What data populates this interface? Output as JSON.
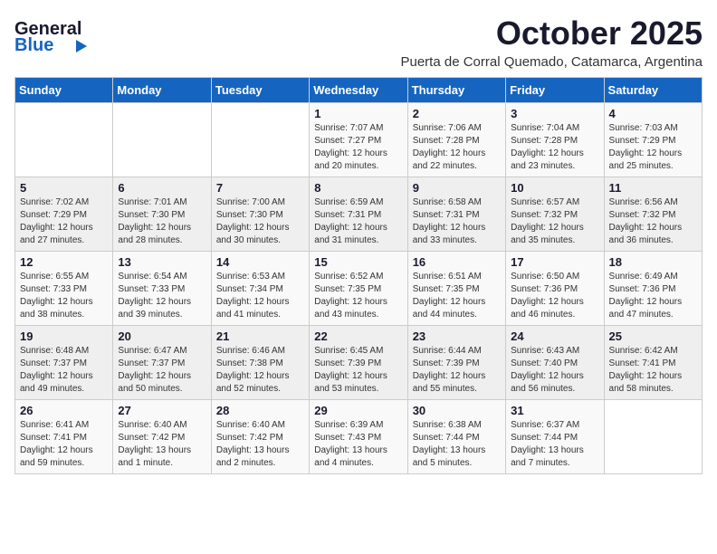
{
  "header": {
    "logo_general": "General",
    "logo_blue": "Blue",
    "month_title": "October 2025",
    "subtitle": "Puerta de Corral Quemado, Catamarca, Argentina"
  },
  "calendar": {
    "days_of_week": [
      "Sunday",
      "Monday",
      "Tuesday",
      "Wednesday",
      "Thursday",
      "Friday",
      "Saturday"
    ],
    "weeks": [
      [
        {
          "day": "",
          "info": ""
        },
        {
          "day": "",
          "info": ""
        },
        {
          "day": "",
          "info": ""
        },
        {
          "day": "1",
          "info": "Sunrise: 7:07 AM\nSunset: 7:27 PM\nDaylight: 12 hours\nand 20 minutes."
        },
        {
          "day": "2",
          "info": "Sunrise: 7:06 AM\nSunset: 7:28 PM\nDaylight: 12 hours\nand 22 minutes."
        },
        {
          "day": "3",
          "info": "Sunrise: 7:04 AM\nSunset: 7:28 PM\nDaylight: 12 hours\nand 23 minutes."
        },
        {
          "day": "4",
          "info": "Sunrise: 7:03 AM\nSunset: 7:29 PM\nDaylight: 12 hours\nand 25 minutes."
        }
      ],
      [
        {
          "day": "5",
          "info": "Sunrise: 7:02 AM\nSunset: 7:29 PM\nDaylight: 12 hours\nand 27 minutes."
        },
        {
          "day": "6",
          "info": "Sunrise: 7:01 AM\nSunset: 7:30 PM\nDaylight: 12 hours\nand 28 minutes."
        },
        {
          "day": "7",
          "info": "Sunrise: 7:00 AM\nSunset: 7:30 PM\nDaylight: 12 hours\nand 30 minutes."
        },
        {
          "day": "8",
          "info": "Sunrise: 6:59 AM\nSunset: 7:31 PM\nDaylight: 12 hours\nand 31 minutes."
        },
        {
          "day": "9",
          "info": "Sunrise: 6:58 AM\nSunset: 7:31 PM\nDaylight: 12 hours\nand 33 minutes."
        },
        {
          "day": "10",
          "info": "Sunrise: 6:57 AM\nSunset: 7:32 PM\nDaylight: 12 hours\nand 35 minutes."
        },
        {
          "day": "11",
          "info": "Sunrise: 6:56 AM\nSunset: 7:32 PM\nDaylight: 12 hours\nand 36 minutes."
        }
      ],
      [
        {
          "day": "12",
          "info": "Sunrise: 6:55 AM\nSunset: 7:33 PM\nDaylight: 12 hours\nand 38 minutes."
        },
        {
          "day": "13",
          "info": "Sunrise: 6:54 AM\nSunset: 7:33 PM\nDaylight: 12 hours\nand 39 minutes."
        },
        {
          "day": "14",
          "info": "Sunrise: 6:53 AM\nSunset: 7:34 PM\nDaylight: 12 hours\nand 41 minutes."
        },
        {
          "day": "15",
          "info": "Sunrise: 6:52 AM\nSunset: 7:35 PM\nDaylight: 12 hours\nand 43 minutes."
        },
        {
          "day": "16",
          "info": "Sunrise: 6:51 AM\nSunset: 7:35 PM\nDaylight: 12 hours\nand 44 minutes."
        },
        {
          "day": "17",
          "info": "Sunrise: 6:50 AM\nSunset: 7:36 PM\nDaylight: 12 hours\nand 46 minutes."
        },
        {
          "day": "18",
          "info": "Sunrise: 6:49 AM\nSunset: 7:36 PM\nDaylight: 12 hours\nand 47 minutes."
        }
      ],
      [
        {
          "day": "19",
          "info": "Sunrise: 6:48 AM\nSunset: 7:37 PM\nDaylight: 12 hours\nand 49 minutes."
        },
        {
          "day": "20",
          "info": "Sunrise: 6:47 AM\nSunset: 7:37 PM\nDaylight: 12 hours\nand 50 minutes."
        },
        {
          "day": "21",
          "info": "Sunrise: 6:46 AM\nSunset: 7:38 PM\nDaylight: 12 hours\nand 52 minutes."
        },
        {
          "day": "22",
          "info": "Sunrise: 6:45 AM\nSunset: 7:39 PM\nDaylight: 12 hours\nand 53 minutes."
        },
        {
          "day": "23",
          "info": "Sunrise: 6:44 AM\nSunset: 7:39 PM\nDaylight: 12 hours\nand 55 minutes."
        },
        {
          "day": "24",
          "info": "Sunrise: 6:43 AM\nSunset: 7:40 PM\nDaylight: 12 hours\nand 56 minutes."
        },
        {
          "day": "25",
          "info": "Sunrise: 6:42 AM\nSunset: 7:41 PM\nDaylight: 12 hours\nand 58 minutes."
        }
      ],
      [
        {
          "day": "26",
          "info": "Sunrise: 6:41 AM\nSunset: 7:41 PM\nDaylight: 12 hours\nand 59 minutes."
        },
        {
          "day": "27",
          "info": "Sunrise: 6:40 AM\nSunset: 7:42 PM\nDaylight: 13 hours\nand 1 minute."
        },
        {
          "day": "28",
          "info": "Sunrise: 6:40 AM\nSunset: 7:42 PM\nDaylight: 13 hours\nand 2 minutes."
        },
        {
          "day": "29",
          "info": "Sunrise: 6:39 AM\nSunset: 7:43 PM\nDaylight: 13 hours\nand 4 minutes."
        },
        {
          "day": "30",
          "info": "Sunrise: 6:38 AM\nSunset: 7:44 PM\nDaylight: 13 hours\nand 5 minutes."
        },
        {
          "day": "31",
          "info": "Sunrise: 6:37 AM\nSunset: 7:44 PM\nDaylight: 13 hours\nand 7 minutes."
        },
        {
          "day": "",
          "info": ""
        }
      ]
    ]
  }
}
